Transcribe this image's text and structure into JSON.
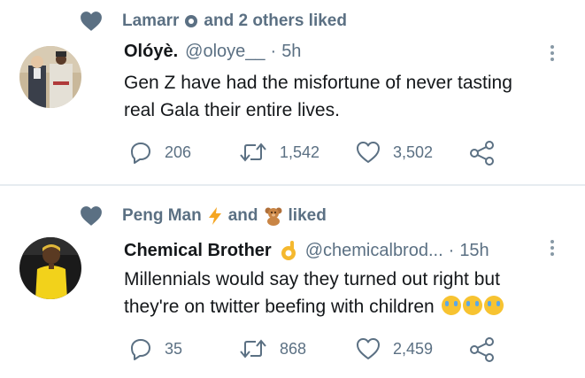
{
  "tweets": [
    {
      "social_context": {
        "name": "Lamarr",
        "rest": "and 2 others liked"
      },
      "author": {
        "name": "Olóyè.",
        "handle": "@oloye__",
        "separator": "·",
        "time": "5h"
      },
      "lines": [
        "Gen Z have had the misfortune of never tasting",
        "real Gala their entire lives."
      ],
      "stats": {
        "replies": "206",
        "retweets": "1,542",
        "likes": "3,502"
      }
    },
    {
      "social_context": {
        "name": "Peng Man",
        "and": "and",
        "liked": "liked"
      },
      "author": {
        "name": "Chemical Brother",
        "handle": "@chemicalbrod...",
        "separator": "·",
        "time": "15h"
      },
      "lines": [
        "Millennials would say they turned out right but",
        "they're on twitter beefing with children"
      ],
      "stats": {
        "replies": "35",
        "retweets": "868",
        "likes": "2,459"
      }
    }
  ],
  "icons": {
    "social_heart": "heart-icon",
    "reply": "reply-icon",
    "retweet": "retweet-icon",
    "like": "like-icon",
    "share": "share-icon",
    "more": "more-vertical-icon"
  },
  "colors": {
    "secondary_text": "#5b7083",
    "divider": "#e6ecf0",
    "social_heart": "#5b7083"
  }
}
